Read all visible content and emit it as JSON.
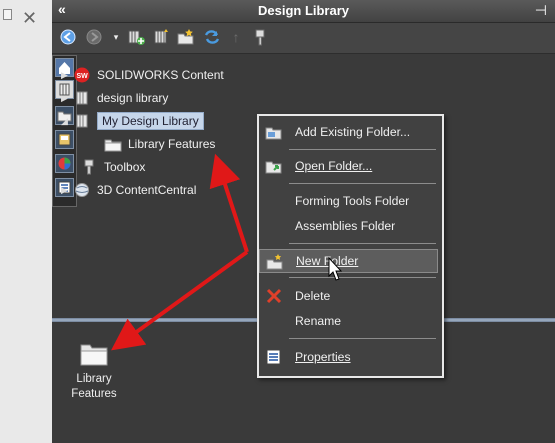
{
  "panel": {
    "title": "Design Library"
  },
  "tree": {
    "items": [
      {
        "label": "SOLIDWORKS Content"
      },
      {
        "label": "design library"
      },
      {
        "label": "My Design Library"
      },
      {
        "label": "Library Features"
      },
      {
        "label": "Toolbox"
      },
      {
        "label": "3D ContentCentral"
      }
    ]
  },
  "lower": {
    "folder_line1": "Library",
    "folder_line2": "Features"
  },
  "context_menu": {
    "items": [
      {
        "label": "Add Existing Folder..."
      },
      {
        "label": "Open Folder..."
      },
      {
        "label": "Forming Tools Folder"
      },
      {
        "label": "Assemblies Folder"
      },
      {
        "label": "New Folder"
      },
      {
        "label": "Delete"
      },
      {
        "label": "Rename"
      },
      {
        "label": "Properties"
      }
    ]
  },
  "colors": {
    "annotation_arrow": "#e01818",
    "selection": "#c6d6ea",
    "panel_bg": "#3a3a3a"
  }
}
